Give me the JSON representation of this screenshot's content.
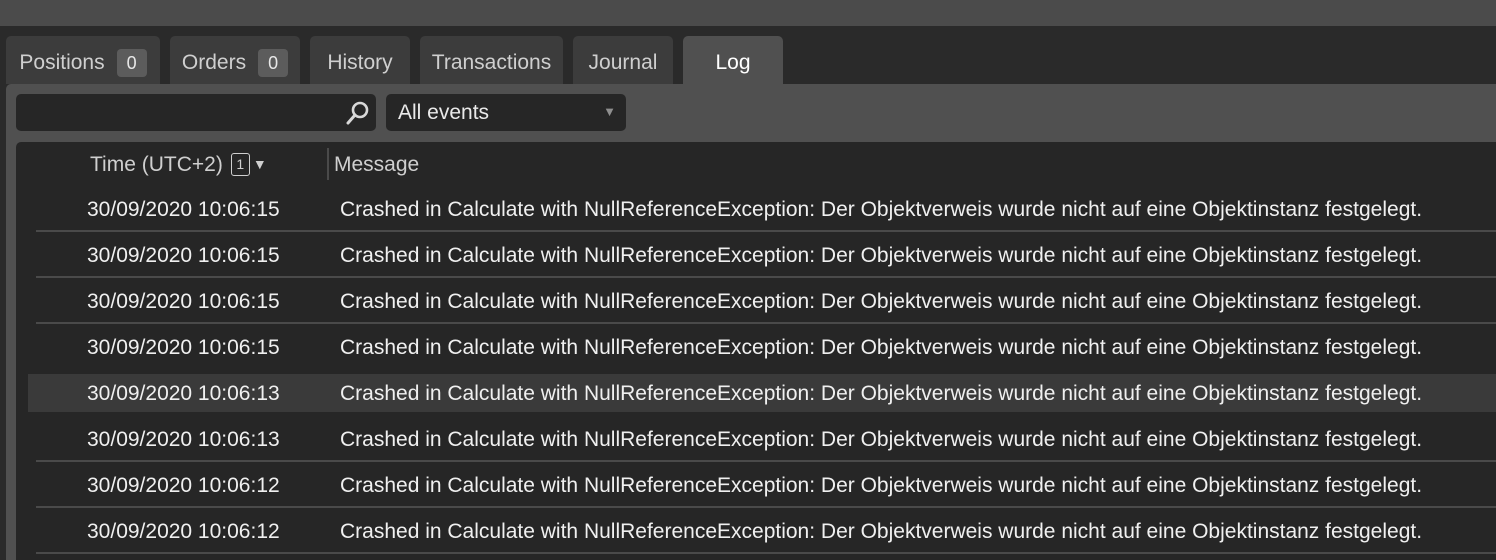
{
  "tabs": [
    {
      "label": "Positions",
      "count": "0"
    },
    {
      "label": "Orders",
      "count": "0"
    },
    {
      "label": "History"
    },
    {
      "label": "Transactions"
    },
    {
      "label": "Journal"
    },
    {
      "label": "Log",
      "active": true
    }
  ],
  "filter": {
    "search_value": "",
    "search_icon": "search-icon",
    "event_filter": "All events",
    "dropdown_icon": "▼"
  },
  "grid": {
    "columns": {
      "time": "Time (UTC+2)",
      "time_sort_index": "1",
      "time_sort_arrow": "▼",
      "message": "Message"
    },
    "rows": [
      {
        "time": "30/09/2020 10:06:15",
        "message": "Crashed in Calculate with NullReferenceException: Der Objektverweis wurde nicht auf eine Objektinstanz festgelegt."
      },
      {
        "time": "30/09/2020 10:06:15",
        "message": "Crashed in Calculate with NullReferenceException: Der Objektverweis wurde nicht auf eine Objektinstanz festgelegt."
      },
      {
        "time": "30/09/2020 10:06:15",
        "message": "Crashed in Calculate with NullReferenceException: Der Objektverweis wurde nicht auf eine Objektinstanz festgelegt."
      },
      {
        "time": "30/09/2020 10:06:15",
        "message": "Crashed in Calculate with NullReferenceException: Der Objektverweis wurde nicht auf eine Objektinstanz festgelegt."
      },
      {
        "time": "30/09/2020 10:06:13",
        "message": "Crashed in Calculate with NullReferenceException: Der Objektverweis wurde nicht auf eine Objektinstanz festgelegt."
      },
      {
        "time": "30/09/2020 10:06:13",
        "message": "Crashed in Calculate with NullReferenceException: Der Objektverweis wurde nicht auf eine Objektinstanz festgelegt."
      },
      {
        "time": "30/09/2020 10:06:12",
        "message": "Crashed in Calculate with NullReferenceException: Der Objektverweis wurde nicht auf eine Objektinstanz festgelegt."
      },
      {
        "time": "30/09/2020 10:06:12",
        "message": "Crashed in Calculate with NullReferenceException: Der Objektverweis wurde nicht auf eine Objektinstanz festgelegt."
      }
    ]
  },
  "colors": {
    "background": "#2a2a2a",
    "panel": "#505050",
    "grid": "#262626",
    "row_highlight": "#3a3a3a"
  }
}
